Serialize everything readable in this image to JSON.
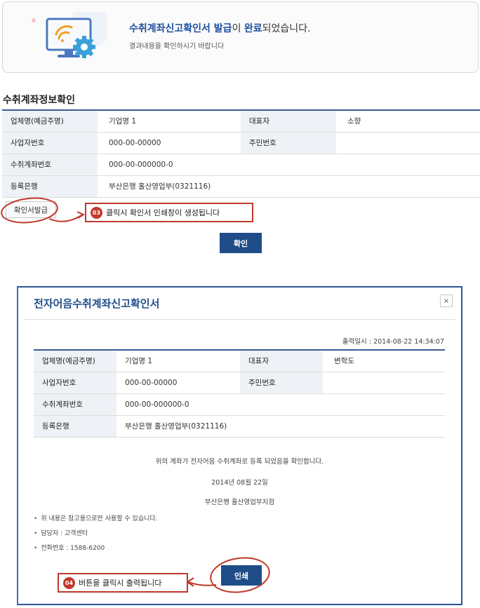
{
  "banner": {
    "title_part1": "수취계좌신고확인서 발급",
    "title_part2": "이 ",
    "title_part3": "완료",
    "title_part4": "되었습니다.",
    "subtitle": "결과내용을 확인하시기 바랍니다",
    "icons": [
      "monitor-icon",
      "wifi-icon",
      "gear-icon"
    ]
  },
  "section": {
    "title": "수취계좌정보확인",
    "rows": [
      {
        "label": "업체명(예금주명)",
        "value": "기업명 1",
        "label2": "대표자",
        "value2": "소향"
      },
      {
        "label": "사업자번호",
        "value": "000-00-00000",
        "label2": "주민번호",
        "value2": ""
      },
      {
        "label": "수취계좌번호",
        "value": "000-00-000000-0"
      },
      {
        "label": "등록은행",
        "value": "부산은행 홀산영업부(0321116)"
      }
    ]
  },
  "actions": {
    "issue_label": "확인서발급",
    "ok_label": "확인"
  },
  "notes": {
    "n03_num": "03",
    "n03_text": "클릭시 확인서 인쇄창이  생성됩니다",
    "n04_num": "04",
    "n04_text": "버튼을 클릭시 출력됩니다"
  },
  "modal": {
    "title": "전자어음수취계좌신고확인서",
    "close": "×",
    "print_date": "출력일시 : 2014-08-22 14:34:07",
    "rows": [
      {
        "label": "업체명(예금주명)",
        "value": "기업명 1",
        "label2": "대표자",
        "value2": "변학도"
      },
      {
        "label": "사업자번호",
        "value": "000-00-00000",
        "label2": "주민번호",
        "value2": ""
      },
      {
        "label": "수취계좌번호",
        "value": "000-00-000000-0"
      },
      {
        "label": "등록은행",
        "value": "부산은행 홀산영업부(0321116)"
      }
    ],
    "confirm_text": "위의 계좌가 전자어음 수취계좌로 등록 되었음을 확인합니다.",
    "date_text": "2014년 08월 22일",
    "branch_text": "부산은행 홀산영업부지점",
    "bullets": [
      "위 내용은 참고용으로만 사용할 수 있습니다.",
      "담당자 : 고객센터",
      "전화번호 : 1588-6200"
    ],
    "print_label": "인쇄"
  },
  "colors": {
    "accent": "#1f4d88",
    "annotation_red": "#c0392b",
    "table_header_bg": "#eef2f7"
  }
}
